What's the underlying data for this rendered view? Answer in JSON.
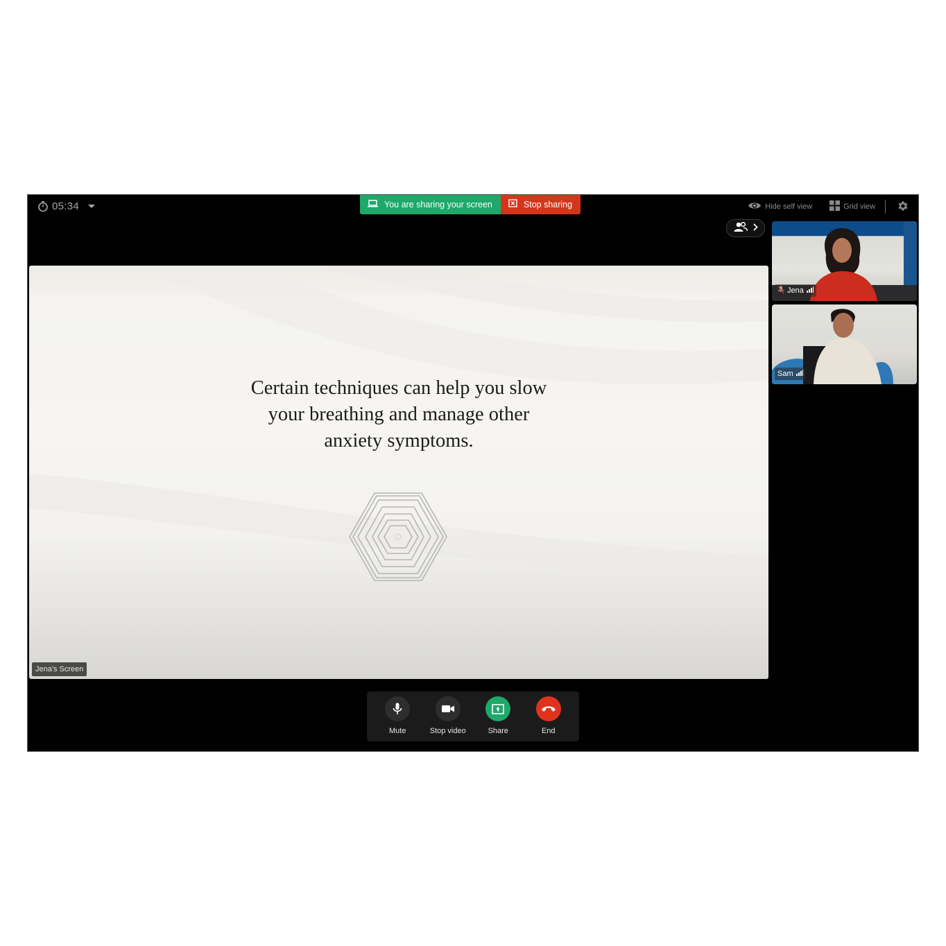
{
  "timer": {
    "value": "05:34",
    "icon": "stopwatch-icon"
  },
  "share_banner": {
    "status_label": "You are sharing your screen",
    "status_icon": "laptop-icon",
    "stop_label": "Stop sharing",
    "stop_icon": "close-box-icon",
    "status_color": "#1ea86a",
    "stop_color": "#d4361c"
  },
  "top_right": {
    "hide_self_view": "Hide self view",
    "grid_view": "Grid view",
    "settings_icon": "gear-icon"
  },
  "shared_screen": {
    "label": "Jena's Screen",
    "slide_lines": [
      "Certain techniques can help you slow",
      "your breathing and manage other",
      "anxiety symptoms."
    ]
  },
  "participants": [
    {
      "name": "Jena",
      "muted": true,
      "signal": "full"
    },
    {
      "name": "Sam",
      "muted": false,
      "signal": "full"
    }
  ],
  "controls": [
    {
      "label": "Mute",
      "icon": "microphone-icon",
      "color": "#2e2e2e"
    },
    {
      "label": "Stop video",
      "icon": "video-camera-icon",
      "color": "#2e2e2e"
    },
    {
      "label": "Share",
      "icon": "share-screen-icon",
      "color": "#1ea86a"
    },
    {
      "label": "End",
      "icon": "hang-up-icon",
      "color": "#e0331e"
    }
  ]
}
